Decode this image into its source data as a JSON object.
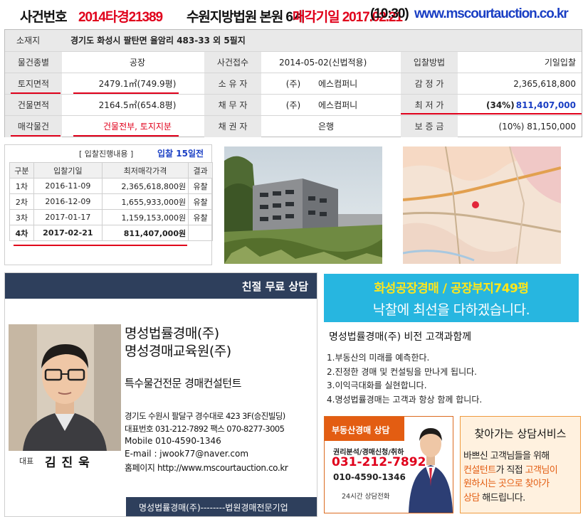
{
  "header": {
    "case_label": "사건번호",
    "case_number": "2014타경21389",
    "court": "수원지방법원 본원 6계",
    "sale_date_label": "매각기일 2017.02.21",
    "sale_time": "(10:30)",
    "website": "www.mscourtauction.co.kr"
  },
  "info": {
    "location_label": "소재지",
    "location_value": "경기도 화성시 팔탄면 율암리 483-33 외 5필지",
    "rows": [
      {
        "l1": "물건종별",
        "v1": "공장",
        "l2": "사건접수",
        "v2a": "2014-05-02(신법적용)",
        "v2b": "",
        "l3": "입찰방법",
        "v3": "기일입찰"
      },
      {
        "l1": "토지면적",
        "v1": "2479.1㎡(749.9평)",
        "l2": "소 유 자",
        "v2a": "(주)",
        "v2b": "에스컴퍼니",
        "l3": "감 정 가",
        "v3": "2,365,618,800"
      },
      {
        "l1": "건물면적",
        "v1": "2164.5㎡(654.8평)",
        "l2": "채 무 자",
        "v2a": "(주)",
        "v2b": "에스컴퍼니",
        "l3": "최 저 가",
        "v3a": "(34%)",
        "v3b": "811,407,000"
      },
      {
        "l1": "매각물건",
        "v1": "건물전부, 토지지분",
        "l2": "채 권 자",
        "v2a": "",
        "v2b": "은행",
        "l3": "보 증 금",
        "v3": "(10%) 81,150,000"
      }
    ]
  },
  "bids": {
    "caption": "[ 입찰진행내용 ]",
    "status": "입찰 15일전",
    "headers": [
      "구분",
      "입찰기일",
      "최저매각가격",
      "결과"
    ],
    "rows": [
      {
        "round": "1차",
        "date": "2016-11-09",
        "price": "2,365,618,800원",
        "result": "유찰"
      },
      {
        "round": "2차",
        "date": "2016-12-09",
        "price": "1,655,933,000원",
        "result": "유찰"
      },
      {
        "round": "3차",
        "date": "2017-01-17",
        "price": "1,159,153,000원",
        "result": "유찰"
      },
      {
        "round": "4차",
        "date": "2017-02-21",
        "price": "811,407,000원",
        "result": ""
      }
    ]
  },
  "adL": {
    "header": "친절 무료 상담",
    "company1": "명성법률경매(주)",
    "company2": "명성경매교육원(주)",
    "title": "특수물건전문 경매컨설턴트",
    "address": "경기도 수원시 팔달구 경수대로 423 3F(승진빌딩)",
    "phones": "대표번호 031-212-7892 팩스 070-8277-3005",
    "mobile": "Mobile  010-4590-1346",
    "email": "E-mail : jwook77@naver.com",
    "homepage": "홈페이지  http://www.mscourtauction.co.kr",
    "ceo_label": "대표",
    "ceo_name": "김 진 욱",
    "footer": "명성법률경매(주)--------법원경매전문기업"
  },
  "banner": {
    "line1": "화성공장경매 / 공장부지749평",
    "line2": "낙찰에 최선을 다하겠습니다."
  },
  "vision": {
    "title": "명성법률경매(주) 비전 고객과함께",
    "items": [
      "1.부동산의 미래를 예측한다.",
      "2.진정한 경매 및 컨설팅을 만나게 됩니다.",
      "3.이익극대화를 실현합니다.",
      "4.명성법률경매는 고객과 항상 함께 합니다."
    ]
  },
  "consult": {
    "header": "부동산경매 상담",
    "services": "권리분석/경매신청/취하",
    "phone": "031-212-7892",
    "mobile": "010-4590-1346",
    "hours": "24시간 상담전화"
  },
  "visit": {
    "title": "찾아가는 상담서비스",
    "t1": "바쁘신 고객님들을 위해",
    "t2a": "컨설턴트",
    "t2b": "가 직접 ",
    "t2c": "고객님이",
    "t3": "원하시는 곳으로 찾아가",
    "t4a": "상담",
    "t4b": " 해드립니다."
  },
  "colors": {
    "accent_red": "#e0001b",
    "accent_blue": "#1a3fc4",
    "navy": "#2e3f5c",
    "banner_blue": "#27b6e0",
    "banner_yellow": "#ffe61a",
    "orange": "#e35d12"
  },
  "icons": {
    "consultant_photo": "person-portrait",
    "consultant_small_photo": "person-portrait-small",
    "building_photo": "building-photo",
    "map": "map-image"
  }
}
